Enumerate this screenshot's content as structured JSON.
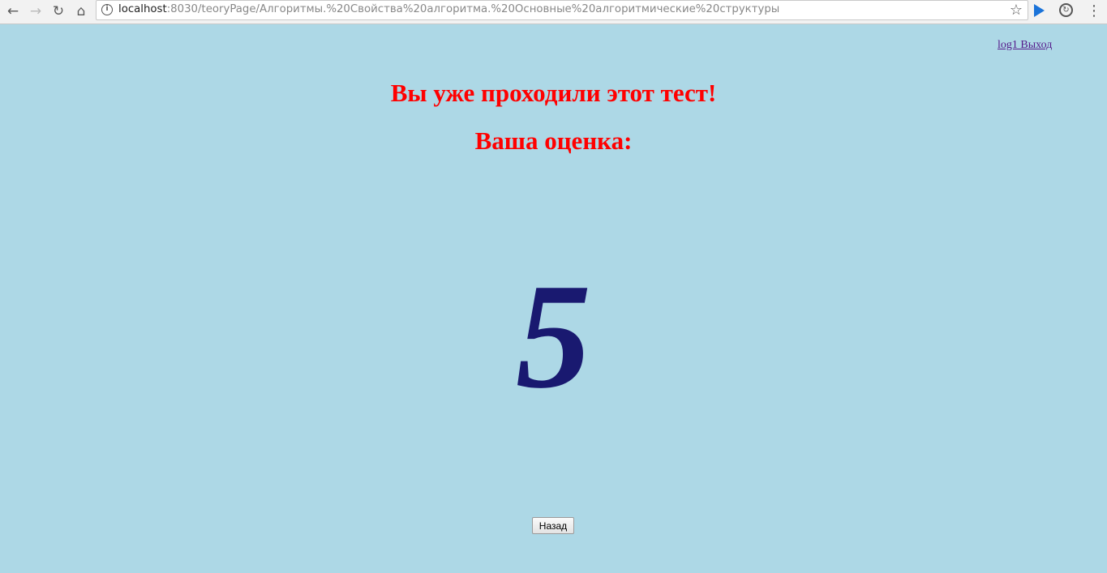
{
  "browser": {
    "url_host": "localhost",
    "url_rest": ":8030/teoryPage/Алгоритмы.%20Свойства%20алгоритма.%20Основные%20алгоритмические%20структуры",
    "icons": [
      "back-icon",
      "forward-icon",
      "reload-icon",
      "home-icon",
      "info-icon",
      "star-icon",
      "play-extension-icon",
      "sync-extension-icon",
      "menu-icon"
    ]
  },
  "header": {
    "user_link": "log1 Выход"
  },
  "main": {
    "heading_already_taken": "Вы уже проходили этот тест!",
    "heading_your_grade": "Ваша оценка:",
    "grade": "5",
    "back_button_label": "Назад"
  },
  "colors": {
    "background": "#add8e6",
    "heading": "#ff0000",
    "grade": "#191970",
    "link": "#551a8b"
  }
}
